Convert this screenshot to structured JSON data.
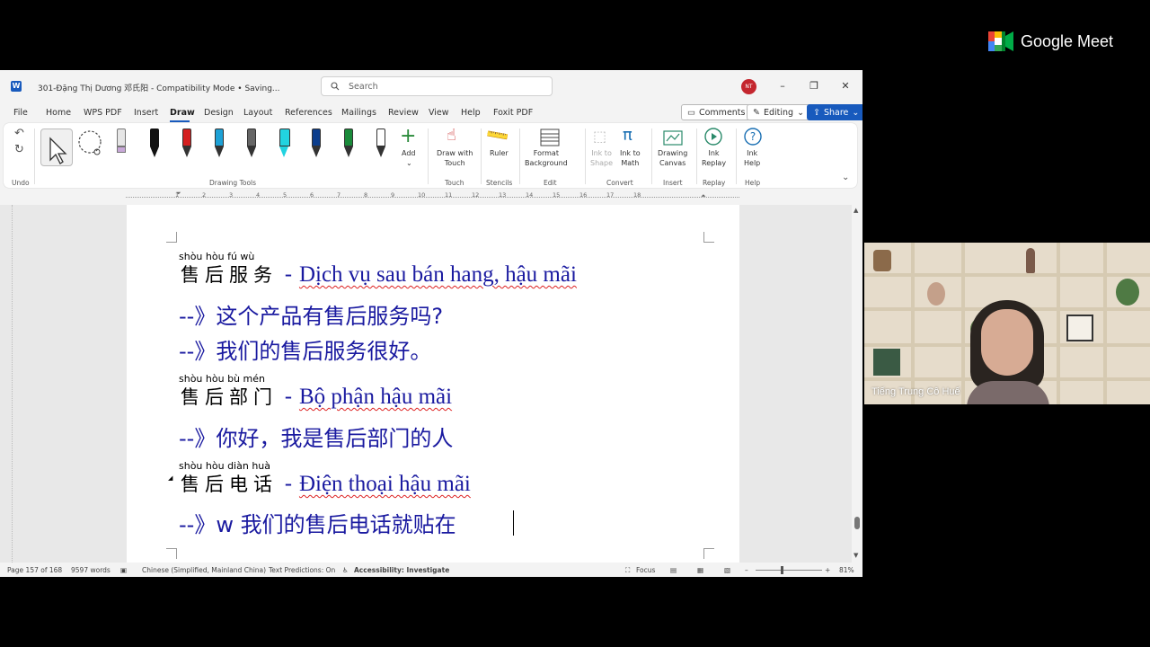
{
  "app": {
    "doc_title": "301-Đặng Thị Dương 邓氏阳  -  Compatibility Mode • Saving...",
    "logo_letter": "W",
    "search_placeholder": "Search",
    "avatar_initials": "NT"
  },
  "menu": {
    "items": [
      "File",
      "Home",
      "WPS PDF",
      "Insert",
      "Draw",
      "Design",
      "Layout",
      "References",
      "Mailings",
      "Review",
      "View",
      "Help",
      "Foxit PDF"
    ],
    "active": "Draw",
    "comments": "Comments",
    "editing": "Editing",
    "share": "Share"
  },
  "ribbon": {
    "groups": {
      "undo": "Undo",
      "drawing_tools": "Drawing Tools",
      "touch": "Touch",
      "stencils": "Stencils",
      "edit": "Edit",
      "convert": "Convert",
      "insert": "Insert",
      "replay": "Replay",
      "help": "Help"
    },
    "buttons": {
      "add": "Add",
      "draw_with_touch": "Draw with\nTouch",
      "ruler": "Ruler",
      "format_background": "Format\nBackground",
      "ink_to_shape": "Ink to\nShape",
      "ink_to_math": "Ink to\nMath",
      "drawing_canvas": "Drawing\nCanvas",
      "ink_replay": "Ink\nReplay",
      "ink_help": "Ink\nHelp"
    },
    "pen_colors": [
      "#e6e6e6",
      "#111111",
      "#d42020",
      "#1da1d6",
      "#555555",
      "#22d3e0",
      "#0b3d8c",
      "#1a8a3a",
      "#ffffff"
    ]
  },
  "ruler": {
    "ticks": [
      "1",
      "2",
      "3",
      "4",
      "5",
      "6",
      "7",
      "8",
      "9",
      "10",
      "11",
      "12",
      "13",
      "14",
      "15",
      "16",
      "17",
      "18"
    ]
  },
  "document": {
    "blocks": [
      {
        "pinyin": "shòu hòu   fú    wù",
        "hanzi": "售后服务",
        "vn": "Dịch vụ sau bán hang, hậu mãi"
      },
      {
        "sentence": "--》这个产品有售后服务吗?"
      },
      {
        "sentence": "--》我们的售后服务很好。"
      },
      {
        "pinyin": "shòu hòu   bù  mén",
        "hanzi": "售后部门",
        "vn": "Bộ phận hậu mãi"
      },
      {
        "sentence": "--》你好，我是售后部门的人"
      },
      {
        "pinyin": "shòu hòu diàn huà",
        "hanzi": "售后电话",
        "vn": "Điện thoại hậu mãi"
      },
      {
        "sentence": "--》w 我们的售后电话就贴在"
      }
    ],
    "dash": "-"
  },
  "status": {
    "page": "Page 157 of 168",
    "words": "9597 words",
    "language": "Chinese (Simplified, Mainland China)",
    "predictions": "Text Predictions: On",
    "accessibility": "Accessibility: Investigate",
    "focus": "Focus",
    "zoom": "81%"
  },
  "meet": {
    "brand": "Google Meet",
    "participant": "Tiếng Trung Cô Huế"
  }
}
